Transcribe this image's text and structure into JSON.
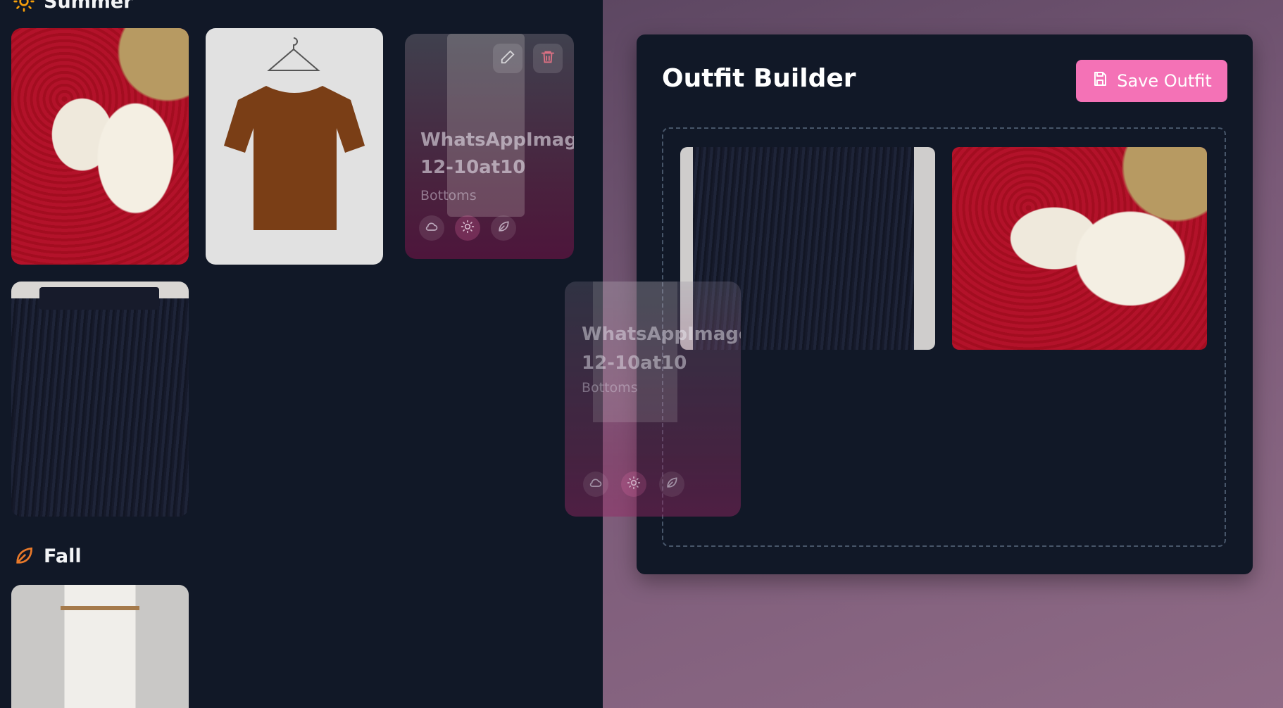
{
  "wardrobe": {
    "sections": [
      {
        "name": "Summer",
        "icon": "sun-icon"
      },
      {
        "name": "Fall",
        "icon": "leaf-icon"
      }
    ],
    "hovered_item": {
      "title_line1": "WhatsAppImage",
      "title_line2": "12-10at10",
      "category": "Bottoms",
      "seasons": [
        "cloud-icon",
        "sun-icon",
        "leaf-icon"
      ],
      "actions": [
        "pencil-icon",
        "trash-icon"
      ]
    }
  },
  "drag_preview": {
    "title_line1": "WhatsAppImage",
    "title_line2": "12-10at10",
    "category": "Bottoms"
  },
  "builder": {
    "title": "Outfit Builder",
    "save_label": "Save Outfit",
    "items": [
      "black-tulle-skirt",
      "white-lace-blouse"
    ]
  },
  "colors": {
    "accent": "#f472b6",
    "panel": "#111827",
    "summer_icon": "#f59e0b",
    "fall_icon": "#ea7a2a"
  }
}
